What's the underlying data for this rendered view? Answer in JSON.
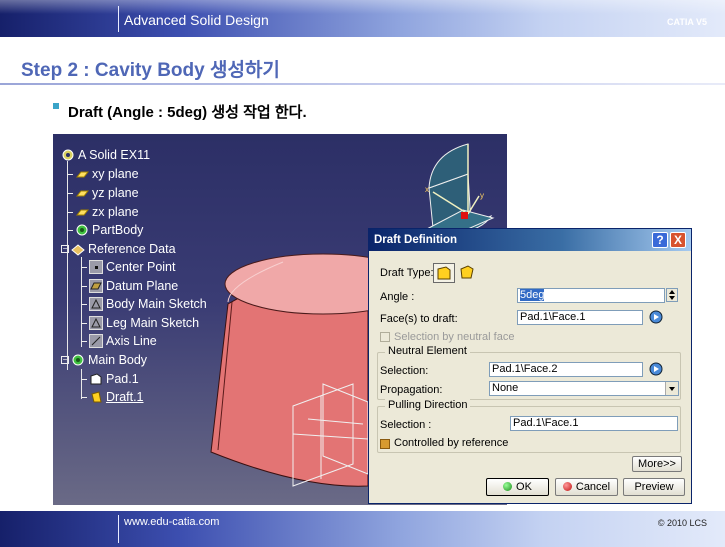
{
  "header": {
    "title": "Advanced Solid Design",
    "right": "CATIA V5"
  },
  "slide": {
    "title": "Step 2 : Cavity Body 생성하기",
    "bullet": "Draft (Angle : 5deg) 생성 작업 한다."
  },
  "footer": {
    "url": "www.edu-catia.com",
    "copyright": "© 2010 LCS"
  },
  "tree": [
    {
      "label": "A Solid EX11",
      "icon": "product-icon"
    },
    {
      "label": "xy plane",
      "icon": "plane-icon"
    },
    {
      "label": "yz plane",
      "icon": "plane-icon"
    },
    {
      "label": "zx plane",
      "icon": "plane-icon"
    },
    {
      "label": "PartBody",
      "icon": "gear-icon"
    },
    {
      "label": "Reference Data",
      "icon": "geoset-icon"
    },
    {
      "label": "Center Point",
      "icon": "point-icon"
    },
    {
      "label": "Datum Plane",
      "icon": "datum-plane-icon"
    },
    {
      "label": "Body Main Sketch",
      "icon": "sketch-icon"
    },
    {
      "label": "Leg Main Sketch",
      "icon": "sketch-icon"
    },
    {
      "label": "Axis Line",
      "icon": "line-icon"
    },
    {
      "label": "Main Body",
      "icon": "gear-icon"
    },
    {
      "label": "Pad.1",
      "icon": "pad-icon"
    },
    {
      "label": "Draft.1",
      "icon": "draft-icon"
    }
  ],
  "dialog": {
    "title": "Draft Definition",
    "help_btn": "?",
    "close_btn": "X",
    "draft_type_label": "Draft Type:",
    "angle_label": "Angle :",
    "angle_value": "5deg",
    "faces_label": "Face(s) to draft:",
    "faces_value": "Pad.1\\Face.1",
    "neutral_selection_label": "Selection by neutral face",
    "neutral_group": "Neutral Element",
    "selection_label": "Selection:",
    "neutral_selection_value": "Pad.1\\Face.2",
    "propagation_label": "Propagation:",
    "propagation_value": "None",
    "pulling_group": "Pulling Direction",
    "pulling_selection_label": "Selection :",
    "pulling_selection_value": "Pad.1\\Face.1",
    "controlled_label": "Controlled by reference",
    "more_btn": "More>>",
    "ok_btn": "OK",
    "cancel_btn": "Cancel",
    "preview_btn": "Preview"
  },
  "colors": {
    "viewport_bg": "#2c2f66",
    "part_face": "#e07272",
    "part_top": "#f0a0a0",
    "dialog_bg": "#ece9d8",
    "title_accent": "#4f67b6"
  }
}
